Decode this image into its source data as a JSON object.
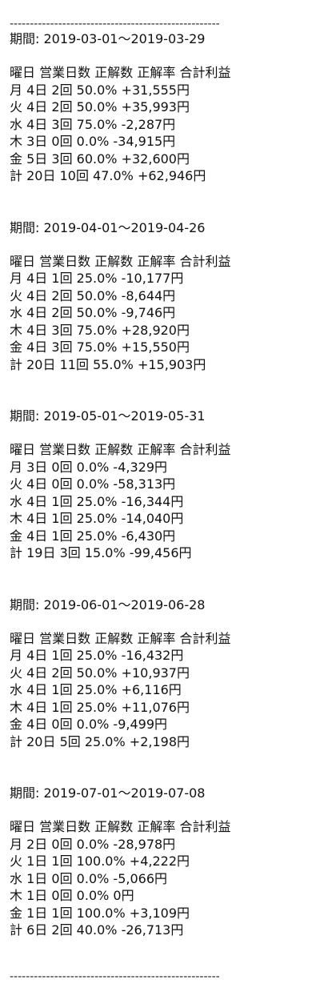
{
  "separator": "----------------------------------------------------",
  "header": {
    "day": "曜日",
    "business_days": "営業日数",
    "correct": "正解数",
    "accuracy": "正解率",
    "profit": "合計利益"
  },
  "blocks": [
    {
      "period": "期間: 2019-03-01～2019-03-29",
      "rows": [
        {
          "day": "月",
          "days": "4日",
          "hits": "2回",
          "rate": "50.0%",
          "profit": "+31,555円"
        },
        {
          "day": "火",
          "days": "4日",
          "hits": "2回",
          "rate": "50.0%",
          "profit": "+35,993円"
        },
        {
          "day": "水",
          "days": "4日",
          "hits": "3回",
          "rate": "75.0%",
          "profit": "-2,287円"
        },
        {
          "day": "木",
          "days": "3日",
          "hits": "0回",
          "rate": "0.0%",
          "profit": "-34,915円"
        },
        {
          "day": "金",
          "days": "5日",
          "hits": "3回",
          "rate": "60.0%",
          "profit": "+32,600円"
        },
        {
          "day": "計",
          "days": "20日",
          "hits": "10回",
          "rate": "47.0%",
          "profit": "+62,946円"
        }
      ]
    },
    {
      "period": "期間: 2019-04-01～2019-04-26",
      "rows": [
        {
          "day": "月",
          "days": "4日",
          "hits": "1回",
          "rate": "25.0%",
          "profit": "-10,177円"
        },
        {
          "day": "火",
          "days": "4日",
          "hits": "2回",
          "rate": "50.0%",
          "profit": "-8,644円"
        },
        {
          "day": "水",
          "days": "4日",
          "hits": "2回",
          "rate": "50.0%",
          "profit": "-9,746円"
        },
        {
          "day": "木",
          "days": "4日",
          "hits": "3回",
          "rate": "75.0%",
          "profit": "+28,920円"
        },
        {
          "day": "金",
          "days": "4日",
          "hits": "3回",
          "rate": "75.0%",
          "profit": "+15,550円"
        },
        {
          "day": "計",
          "days": "20日",
          "hits": "11回",
          "rate": "55.0%",
          "profit": "+15,903円"
        }
      ]
    },
    {
      "period": "期間: 2019-05-01～2019-05-31",
      "rows": [
        {
          "day": "月",
          "days": "3日",
          "hits": "0回",
          "rate": "0.0%",
          "profit": "-4,329円"
        },
        {
          "day": "火",
          "days": "4日",
          "hits": "0回",
          "rate": "0.0%",
          "profit": "-58,313円"
        },
        {
          "day": "水",
          "days": "4日",
          "hits": "1回",
          "rate": "25.0%",
          "profit": "-16,344円"
        },
        {
          "day": "木",
          "days": "4日",
          "hits": "1回",
          "rate": "25.0%",
          "profit": "-14,040円"
        },
        {
          "day": "金",
          "days": "4日",
          "hits": "1回",
          "rate": "25.0%",
          "profit": "-6,430円"
        },
        {
          "day": "計",
          "days": "19日",
          "hits": "3回",
          "rate": "15.0%",
          "profit": "-99,456円"
        }
      ]
    },
    {
      "period": "期間: 2019-06-01～2019-06-28",
      "rows": [
        {
          "day": "月",
          "days": "4日",
          "hits": "1回",
          "rate": "25.0%",
          "profit": "-16,432円"
        },
        {
          "day": "火",
          "days": "4日",
          "hits": "2回",
          "rate": "50.0%",
          "profit": "+10,937円"
        },
        {
          "day": "水",
          "days": "4日",
          "hits": "1回",
          "rate": "25.0%",
          "profit": "+6,116円"
        },
        {
          "day": "木",
          "days": "4日",
          "hits": "1回",
          "rate": "25.0%",
          "profit": "+11,076円"
        },
        {
          "day": "金",
          "days": "4日",
          "hits": "0回",
          "rate": "0.0%",
          "profit": "-9,499円"
        },
        {
          "day": "計",
          "days": "20日",
          "hits": "5回",
          "rate": "25.0%",
          "profit": "+2,198円"
        }
      ]
    },
    {
      "period": "期間: 2019-07-01～2019-07-08",
      "rows": [
        {
          "day": "月",
          "days": "2日",
          "hits": "0回",
          "rate": "0.0%",
          "profit": "-28,978円"
        },
        {
          "day": "火",
          "days": "1日",
          "hits": "1回",
          "rate": "100.0%",
          "profit": "+4,222円"
        },
        {
          "day": "水",
          "days": "1日",
          "hits": "0回",
          "rate": "0.0%",
          "profit": "-5,066円"
        },
        {
          "day": "木",
          "days": "1日",
          "hits": "0回",
          "rate": "0.0%",
          "profit": "0円"
        },
        {
          "day": "金",
          "days": "1日",
          "hits": "1回",
          "rate": "100.0%",
          "profit": "+3,109円"
        },
        {
          "day": "計",
          "days": "6日",
          "hits": "2回",
          "rate": "40.0%",
          "profit": "-26,713円"
        }
      ]
    }
  ]
}
